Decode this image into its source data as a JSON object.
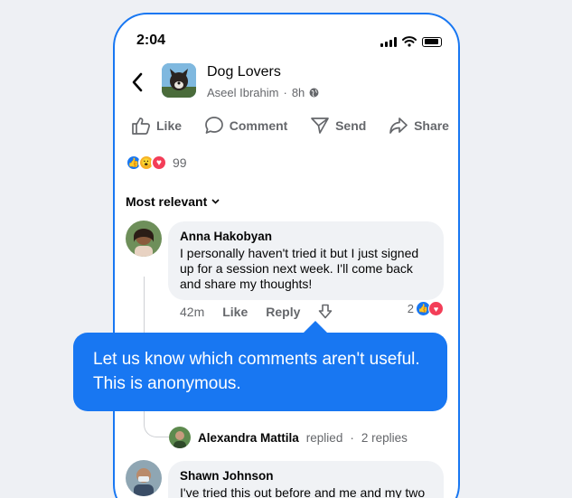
{
  "status_bar": {
    "time": "2:04"
  },
  "post": {
    "group_name": "Dog Lovers",
    "author": "Aseel Ibrahim",
    "age": "8h",
    "separator": "·"
  },
  "actions": {
    "like": "Like",
    "comment": "Comment",
    "send": "Send",
    "share": "Share"
  },
  "reactions": {
    "count": "99"
  },
  "sort": {
    "label": "Most relevant"
  },
  "comments": [
    {
      "name": "Anna Hakobyan",
      "text": "I personally haven't tried it but I just signed up for a session next week. I'll come back and share my thoughts!",
      "time": "42m",
      "like_label": "Like",
      "reply_label": "Reply",
      "reaction_count": "2"
    },
    {
      "name": "Shawn Johnson",
      "text": "I've tried this out before and me and my two"
    }
  ],
  "reply_summary": {
    "name": "Alexandra Mattila",
    "replied": "replied",
    "separator": "·",
    "count": "2 replies"
  },
  "tooltip": {
    "text": "Let us know which comments aren't useful. This is anonymous."
  },
  "colors": {
    "accent": "#1877f2",
    "love": "#f33e58",
    "wow": "#f7b125"
  },
  "icons": [
    "back-arrow-icon",
    "globe-icon",
    "like-icon",
    "comment-icon",
    "send-icon",
    "share-icon",
    "downvote-icon",
    "chevron-down-icon"
  ]
}
